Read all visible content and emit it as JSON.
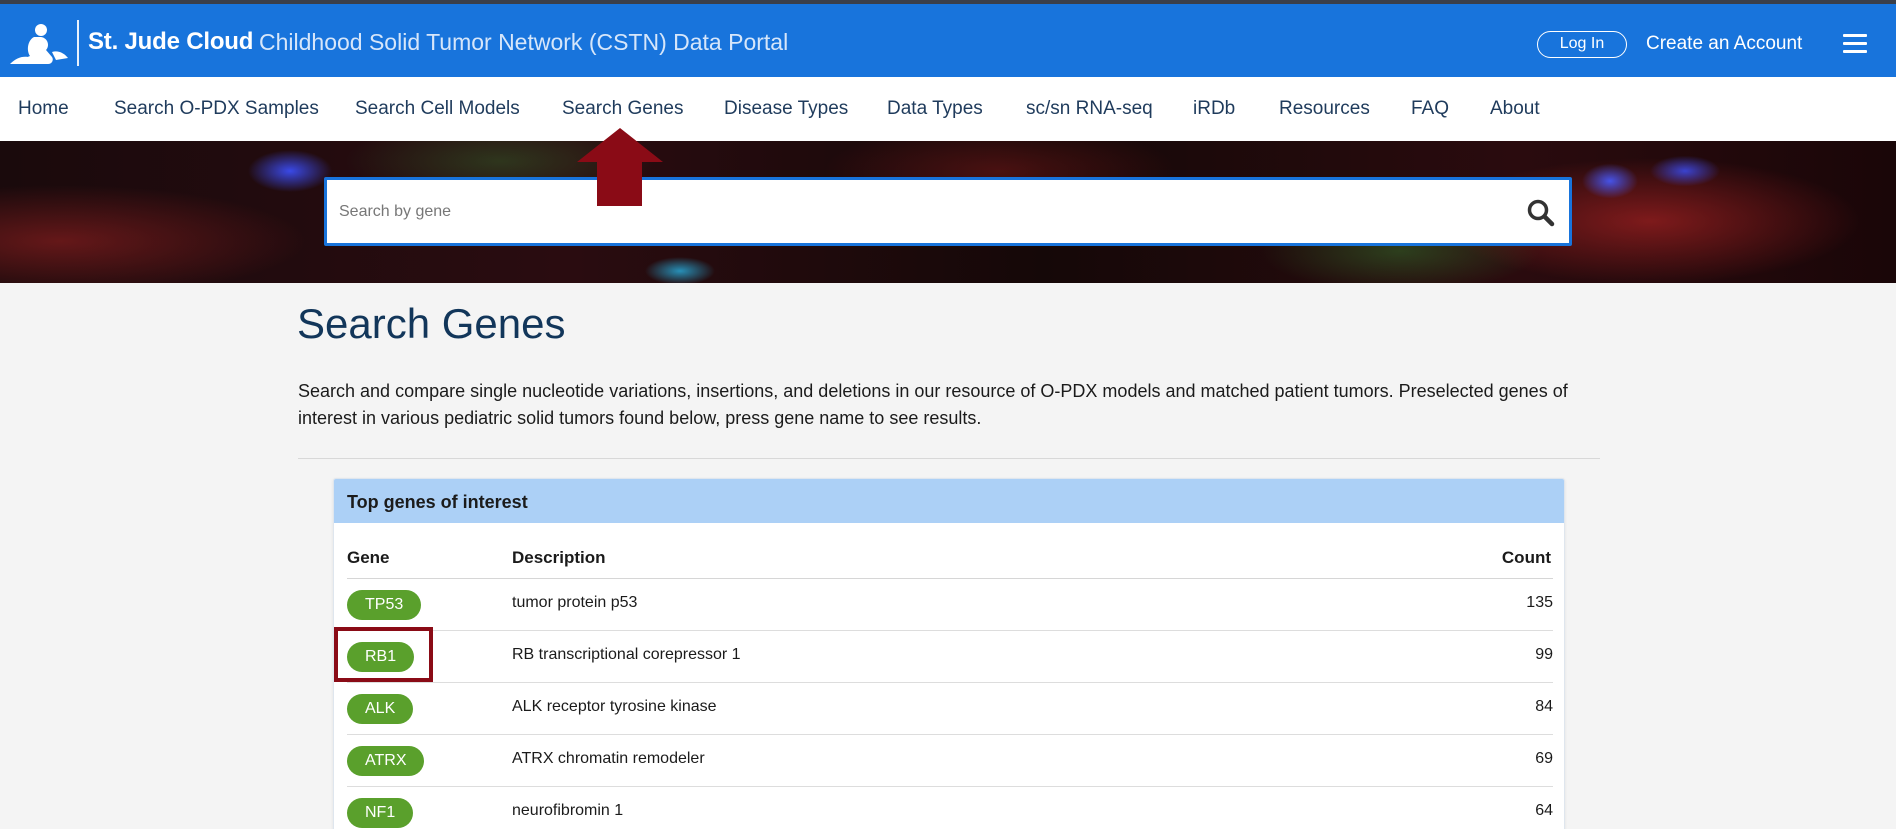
{
  "header": {
    "brand": "St. Jude Cloud",
    "portal_title": "Childhood Solid Tumor Network (CSTN) Data Portal",
    "login_label": "Log In",
    "create_account_label": "Create an Account",
    "logo_icon": "st-jude-child-logo-icon",
    "menu_icon": "hamburger-menu-icon"
  },
  "nav": {
    "items": [
      {
        "label": "Home"
      },
      {
        "label": "Search O-PDX Samples"
      },
      {
        "label": "Search Cell Models"
      },
      {
        "label": "Search Genes"
      },
      {
        "label": "Disease Types"
      },
      {
        "label": "Data Types"
      },
      {
        "label": "sc/sn RNA-seq"
      },
      {
        "label": "iRDb"
      },
      {
        "label": "Resources"
      },
      {
        "label": "FAQ"
      },
      {
        "label": "About"
      }
    ]
  },
  "search": {
    "placeholder": "Search by gene",
    "value": "",
    "icon": "search-icon"
  },
  "main": {
    "title": "Search Genes",
    "intro": "Search and compare single nucleotide variations, insertions, and deletions in our resource of O-PDX models and matched patient tumors. Preselected genes of interest in various pediatric solid tumors found below, press gene name to see results."
  },
  "top_genes": {
    "title": "Top genes of interest",
    "columns": {
      "gene": "Gene",
      "description": "Description",
      "count": "Count"
    },
    "rows": [
      {
        "gene": "TP53",
        "description": "tumor protein p53",
        "count": "135"
      },
      {
        "gene": "RB1",
        "description": "RB transcriptional corepressor 1",
        "count": "99"
      },
      {
        "gene": "ALK",
        "description": "ALK receptor tyrosine kinase",
        "count": "84"
      },
      {
        "gene": "ATRX",
        "description": "ATRX chromatin remodeler",
        "count": "69"
      },
      {
        "gene": "NF1",
        "description": "neurofibromin 1",
        "count": "64"
      }
    ]
  },
  "colors": {
    "header_blue": "#1874dc",
    "nav_text": "#1f3b5c",
    "gene_pill_green": "#5aa02c",
    "card_header_blue": "#acd0f6",
    "annotation_red": "#8a0b16"
  }
}
